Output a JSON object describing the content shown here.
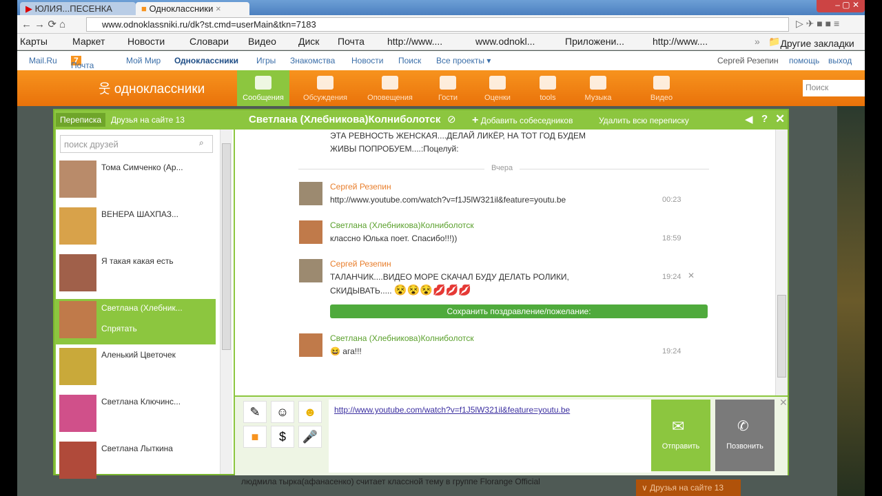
{
  "browser": {
    "tabs": [
      "ЮЛИЯ...ПЕСЕНКА",
      "Одноклассники"
    ],
    "url": "www.odnoklassniki.ru/dk?st.cmd=userMain&tkn=7183",
    "bookmarks": [
      "Карты",
      "Маркет",
      "Новости",
      "Словари",
      "Видео",
      "Диск",
      "Почта",
      "http://www....",
      "www.odnokl...",
      "Приложени...",
      "http://www...."
    ],
    "other_bookmarks": "Другие закладки",
    "more": "»"
  },
  "mailru": {
    "links": [
      "Mail.Ru",
      "Почта",
      "Мой Мир",
      "Одноклассники",
      "Игры",
      "Знакомства",
      "Новости",
      "Поиск",
      "Все проекты ▾"
    ],
    "mail_count": "7",
    "user": "Сергей Резепин",
    "help": "помощь",
    "logout": "выход"
  },
  "header": {
    "logo": "одноклассники",
    "nav": [
      "Сообщения",
      "Обсуждения",
      "Оповещения",
      "Гости",
      "Оценки",
      "tools",
      "Музыка",
      "Видео"
    ],
    "search_placeholder": "Поиск"
  },
  "chat": {
    "tab_active": "Переписка",
    "tab_friends": "Друзья на сайте 13",
    "title": "Светлана (Хлебникова)Колниболотск",
    "add": "Добавить собеседников",
    "delete": "Удалить всю переписку",
    "search_placeholder": "поиск друзей",
    "friends": [
      {
        "name": "Тома Симченко (Ар..."
      },
      {
        "name": "ВЕНЕРА ШАХПАЗ..."
      },
      {
        "name": "Я такая какая есть"
      },
      {
        "name": "Светлана (Хлебник...",
        "sub": "Спрятать"
      },
      {
        "name": "Аленький Цветочек"
      },
      {
        "name": "Светлана Ключинс..."
      },
      {
        "name": "Светлана Лыткина"
      }
    ],
    "prev_text": [
      "ЭТА РЕВНОСТЬ ЖЕНСКАЯ....ДЕЛАЙ ЛИКЁР, НА ТОТ ГОД БУДЕМ",
      "ЖИВЫ ПОПРОБУЕМ....:Поцелуй:"
    ],
    "divider": "Вчера",
    "messages": [
      {
        "author": "Сергей Резепин",
        "lines": [
          "http://www.youtube.com/watch?v=f1J5lW321il&feature=youtu.be"
        ],
        "time": "00:23"
      },
      {
        "author": "Светлана (Хлебникова)Колниболотск",
        "lines": [
          "классно Юлька поет. Спасибо!!!))"
        ],
        "time": "18:59"
      },
      {
        "author": "Сергей Резепин",
        "lines": [
          "ТАЛАНЧИК....ВИДЕО МОРЕ СКАЧАЛ БУДУ ДЕЛАТЬ РОЛИКИ,",
          "СКИДЫВАТЬ....."
        ],
        "time": "19:24"
      },
      {
        "author": "Светлана (Хлебникова)Колниболотск",
        "lines": [
          "ага!!!"
        ],
        "time": "19:24"
      }
    ],
    "save_greeting": "Сохранить поздравление/пожелание:",
    "input_value": "http://www.youtube.com/watch?v=f1J5lW321il&feature=youtu.be",
    "send": "Отправить",
    "call": "Позвонить"
  },
  "background": {
    "feed": "людмила тырка(афанасенко) считает классной тему в группе Florange Official",
    "friends_online": "Друзья на сайте 13"
  }
}
